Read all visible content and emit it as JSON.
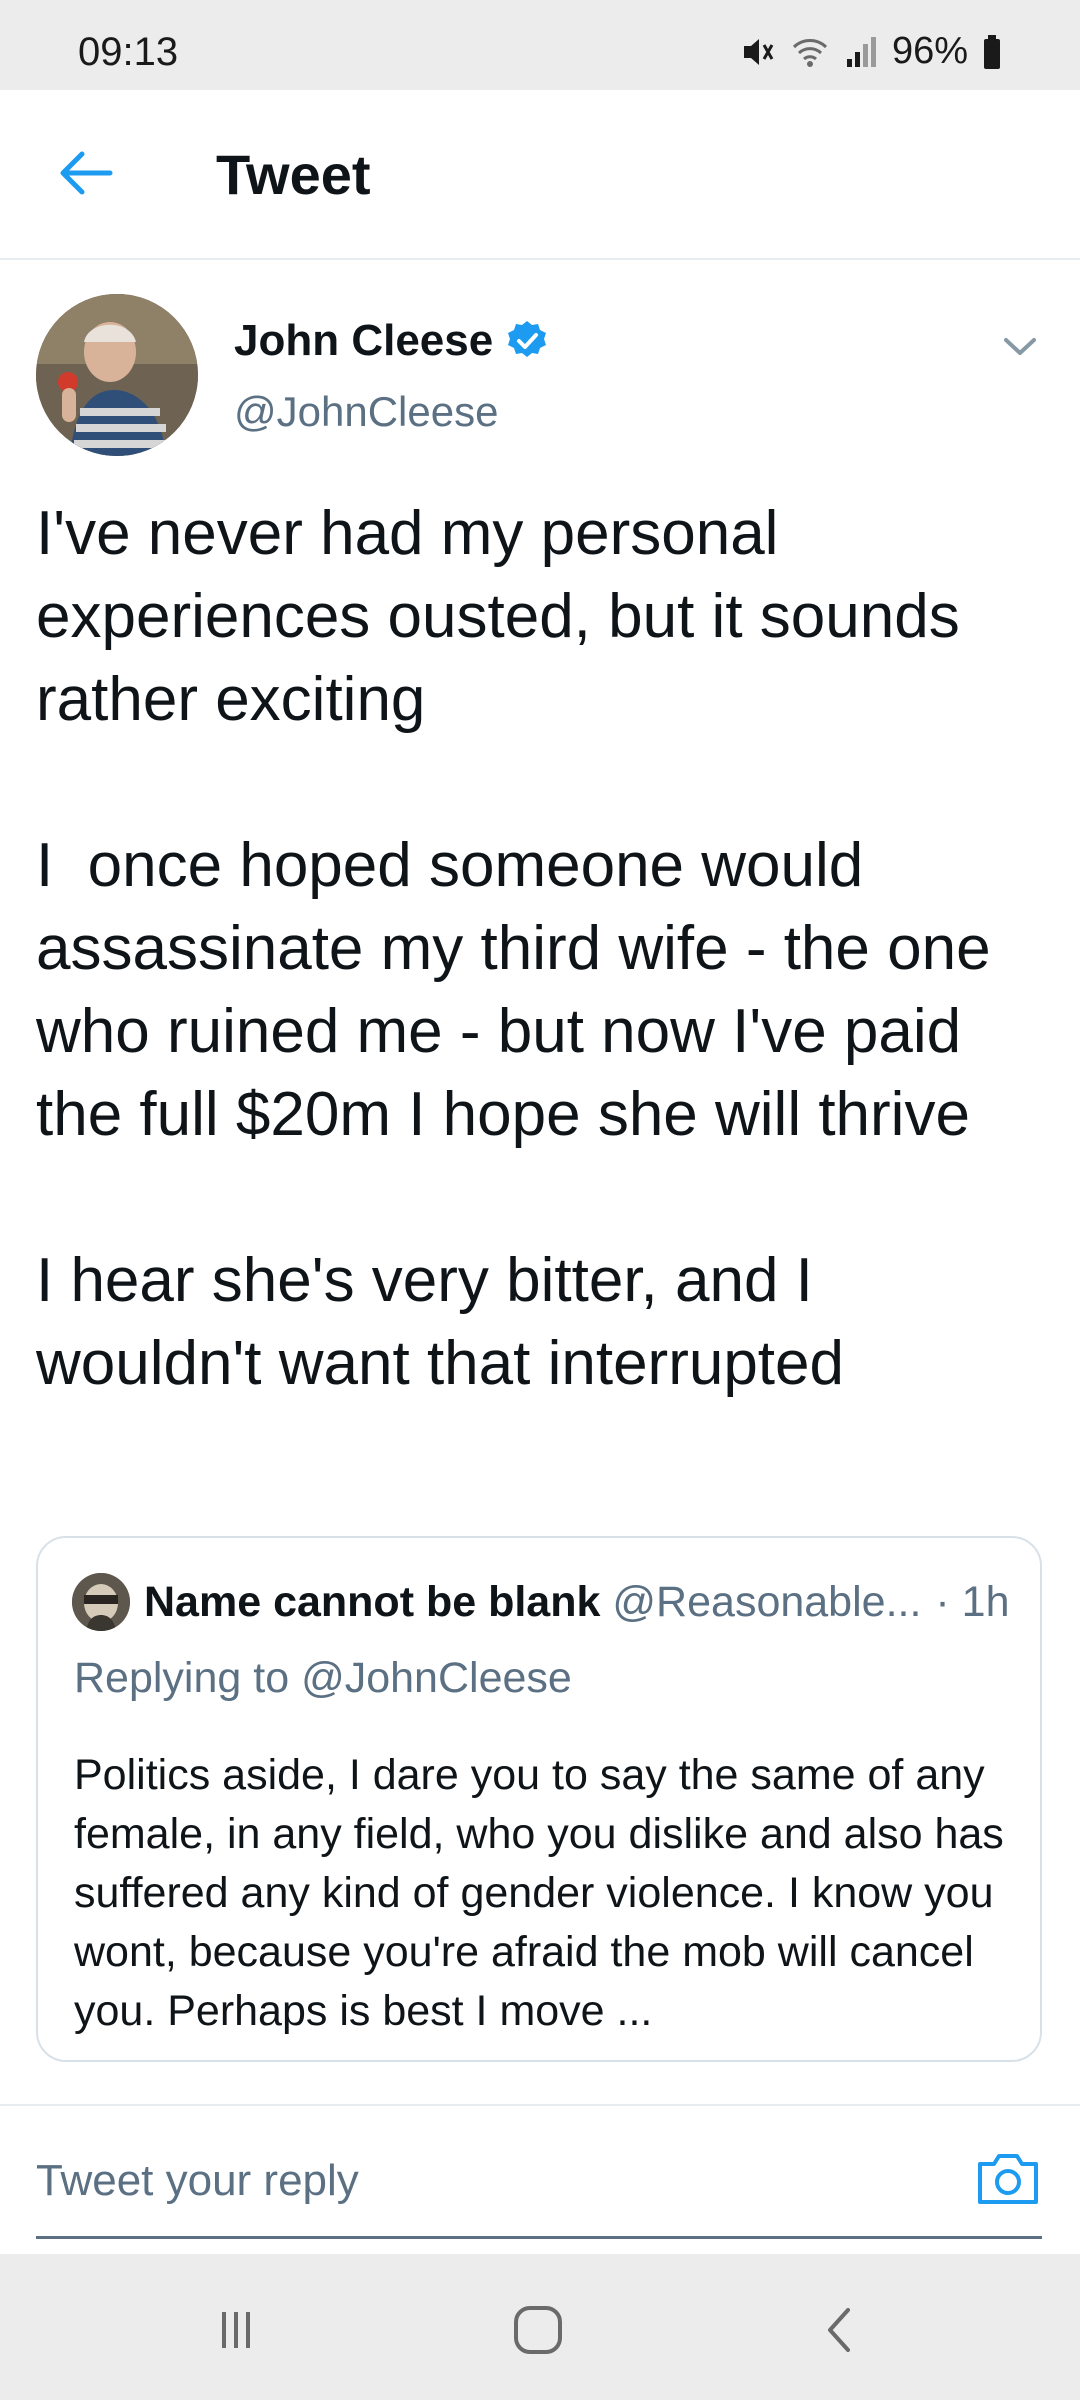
{
  "status_bar": {
    "time": "09:13",
    "battery": "96%",
    "icons": [
      "mute-icon",
      "wifi-icon",
      "signal-icon",
      "battery-icon"
    ]
  },
  "header": {
    "title": "Tweet",
    "back_icon": "arrow-left-icon"
  },
  "tweet": {
    "author_name": "John Cleese",
    "author_handle": "@JohnCleese",
    "verified": true,
    "text": "I've never had my personal experiences ousted, but it sounds rather exciting\n\nI  once hoped someone would assassinate my third wife - the one who ruined me - but now I've paid the full $20m I hope she will thrive\n\nI hear she's very bitter, and I wouldn't want that interrupted"
  },
  "quoted_tweet": {
    "author_name": "Name cannot be blank",
    "author_handle": "@Reasonable...",
    "time": "· 1h",
    "replying_to": "Replying to @JohnCleese",
    "text": "Politics aside, I dare you to say the same of any female, in any field, who you dislike and also has suffered any kind of gender violence. I know you wont, because you're afraid the mob will cancel you. Perhaps is best I move ..."
  },
  "reply_bar": {
    "placeholder": "Tweet your reply",
    "camera_icon": "camera-icon"
  },
  "colors": {
    "accent": "#1d9bf0",
    "secondary_text": "#5b7083",
    "border": "#e6ecf0",
    "system_bar": "#ececec"
  }
}
